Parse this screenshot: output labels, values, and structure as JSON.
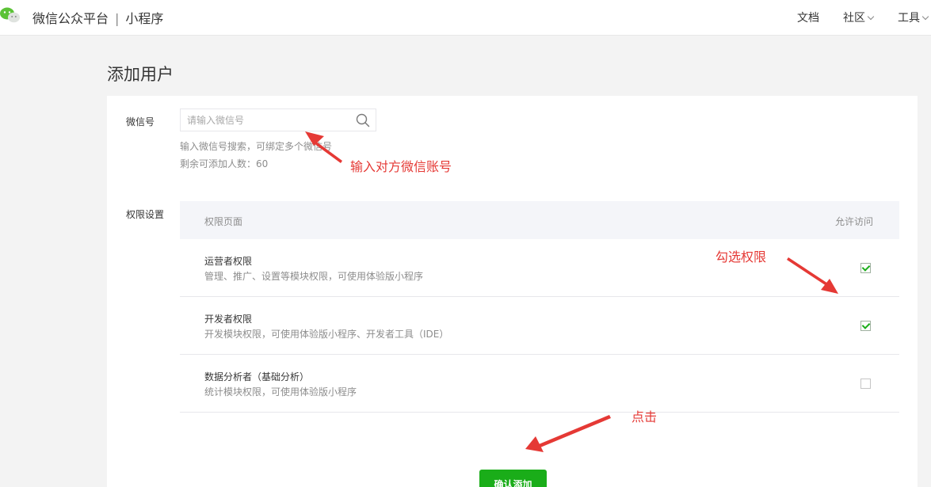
{
  "header": {
    "brand": "微信公众平台",
    "separator": "|",
    "product": "小程序",
    "nav": [
      {
        "label": "文档",
        "has_dropdown": false
      },
      {
        "label": "社区",
        "has_dropdown": true
      },
      {
        "label": "工具",
        "has_dropdown": true
      }
    ]
  },
  "page": {
    "title": "添加用户"
  },
  "form": {
    "wechat_label": "微信号",
    "search_placeholder": "请输入微信号",
    "search_value": "",
    "hint_search": "输入微信号搜索，可绑定多个微信号",
    "hint_remaining": "剩余可添加人数：60",
    "permissions_label": "权限设置",
    "table_headers": {
      "page": "权限页面",
      "allow": "允许访问"
    },
    "permissions": [
      {
        "title": "运营者权限",
        "desc": "管理、推广、设置等模块权限，可使用体验版小程序",
        "checked": true
      },
      {
        "title": "开发者权限",
        "desc": "开发模块权限，可使用体验版小程序、开发者工具（IDE）",
        "checked": true
      },
      {
        "title": "数据分析者（基础分析）",
        "desc": "统计模块权限，可使用体验版小程序",
        "checked": false
      }
    ],
    "confirm_label": "确认添加"
  },
  "annotations": {
    "input_note": "输入对方微信账号",
    "check_note": "勾选权限",
    "click_note": "点击",
    "color": "#e53935"
  },
  "colors": {
    "accent": "#1aad19",
    "background": "#f3f3f3"
  }
}
